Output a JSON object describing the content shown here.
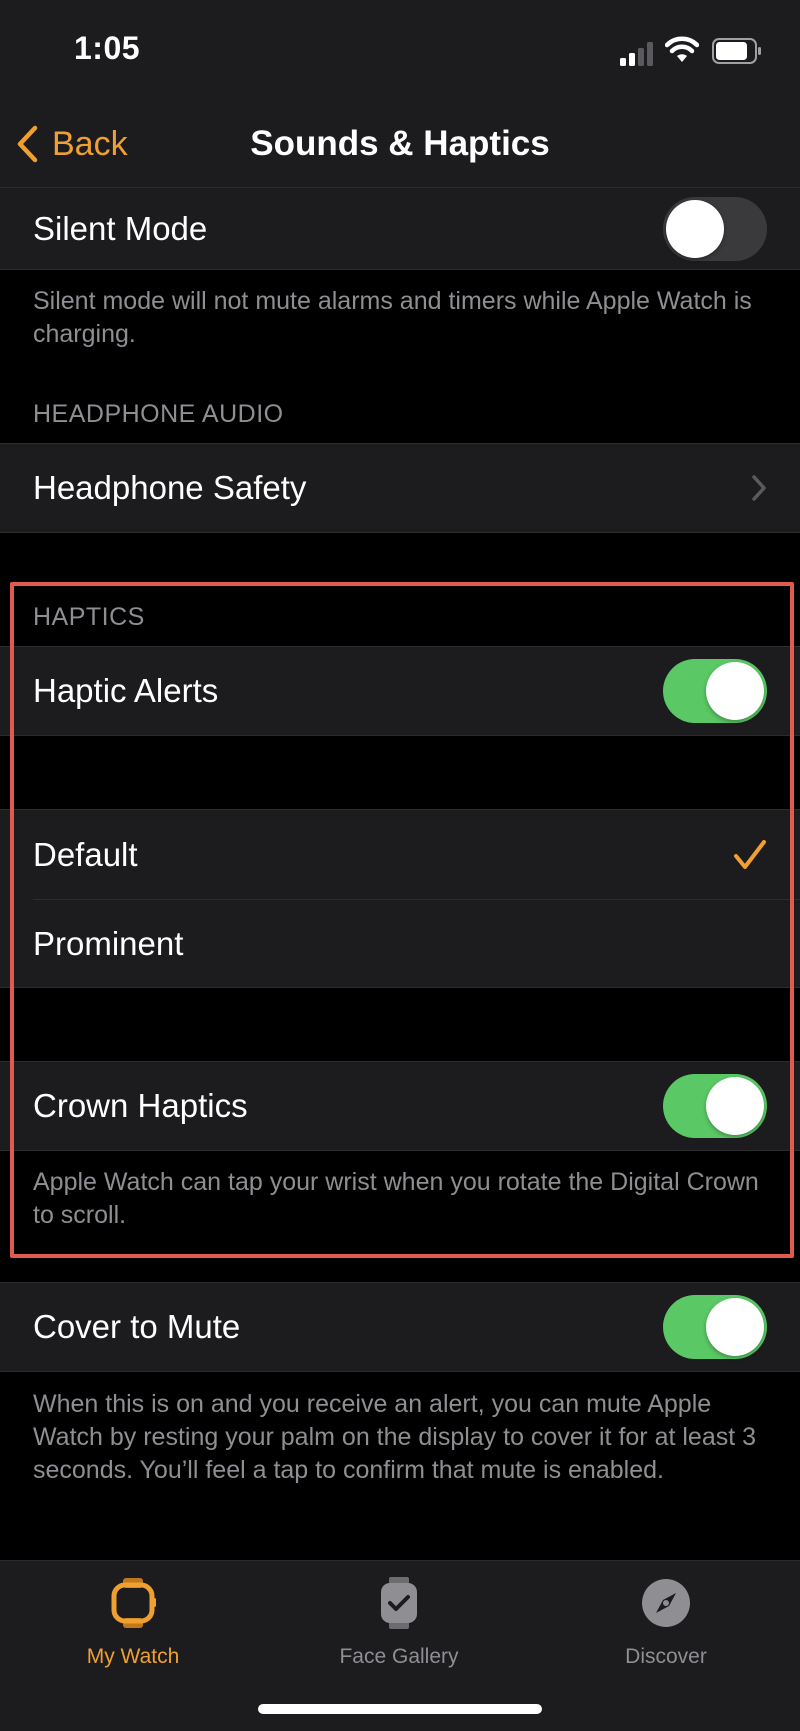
{
  "status": {
    "time": "1:05"
  },
  "nav": {
    "back_label": "Back",
    "title": "Sounds & Haptics"
  },
  "silent_mode": {
    "label": "Silent Mode",
    "on": false,
    "footer": "Silent mode will not mute alarms and timers while Apple Watch is charging."
  },
  "headphone_audio": {
    "header": "HEADPHONE AUDIO",
    "safety_label": "Headphone Safety"
  },
  "haptics": {
    "header": "HAPTICS",
    "alerts_label": "Haptic Alerts",
    "alerts_on": true,
    "options": [
      {
        "label": "Default",
        "selected": true
      },
      {
        "label": "Prominent",
        "selected": false
      }
    ],
    "crown_label": "Crown Haptics",
    "crown_on": true,
    "crown_footer": "Apple Watch can tap your wrist when you rotate the Digital Crown to scroll."
  },
  "cover_to_mute": {
    "label": "Cover to Mute",
    "on": true,
    "footer": "When this is on and you receive an alert, you can mute Apple Watch by resting your palm on the display to cover it for at least 3 seconds. You’ll feel a tap to confirm that mute is enabled."
  },
  "tabs": [
    {
      "label": "My Watch",
      "icon": "watch-icon",
      "active": true
    },
    {
      "label": "Face Gallery",
      "icon": "face-gallery-icon",
      "active": false
    },
    {
      "label": "Discover",
      "icon": "compass-icon",
      "active": false
    }
  ],
  "colors": {
    "accent": "#f0a030",
    "toggle_on": "#5ac864",
    "highlight": "#e05a50",
    "inactive_tab": "#8e8e93"
  }
}
